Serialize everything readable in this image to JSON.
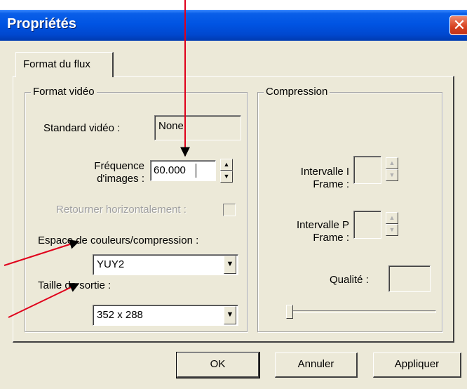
{
  "window": {
    "title": "Propriétés",
    "close_glyph": "✕"
  },
  "tabs": [
    {
      "label": "Format du flux"
    }
  ],
  "video_format": {
    "label": "Format vidéo",
    "standard_label": "Standard vidéo :",
    "standard_value": "None",
    "frame_rate_label_1": "Fréquence",
    "frame_rate_label_2": "d'images :",
    "frame_rate_value": "60.000",
    "flip_label": "Retourner horizontalement :",
    "color_space_label": "Espace de couleurs/compression :",
    "color_space_value": "YUY2",
    "output_size_label": "Taille de sortie :",
    "output_size_value": "352 x 288"
  },
  "compression": {
    "label": "Compression",
    "i_frame_label_1": "Intervalle I",
    "i_frame_label_2": "Frame :",
    "p_frame_label_1": "Intervalle P",
    "p_frame_label_2": "Frame :",
    "quality_label": "Qualité :"
  },
  "buttons": {
    "ok": "OK",
    "cancel": "Annuler",
    "apply": "Appliquer"
  },
  "icons": {
    "spin_up": "▲",
    "spin_down": "▼",
    "dropdown": "▼"
  },
  "colors": {
    "annotation_arrow": "#e0001b",
    "titlebar": "#0054e3",
    "close_button": "#d6401e",
    "dialog_face": "#ece9d8"
  }
}
